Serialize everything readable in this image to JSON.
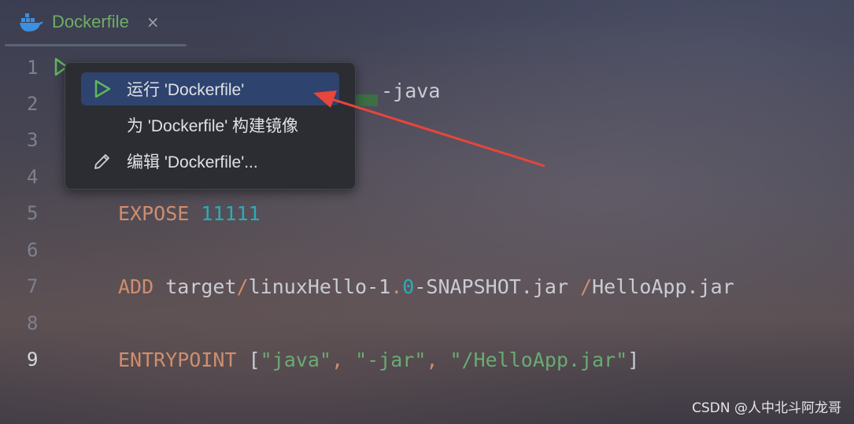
{
  "tab": {
    "title": "Dockerfile",
    "close_glyph": "×",
    "icon": "docker-icon"
  },
  "gutter": {
    "line_numbers": [
      "1",
      "2",
      "3",
      "4",
      "5",
      "6",
      "7",
      "8",
      "9"
    ],
    "active_line": "9"
  },
  "code": {
    "line1": {
      "partial": "-java"
    },
    "line5": {
      "keyword": "EXPOSE",
      "number": "11111"
    },
    "line7": {
      "keyword": "ADD",
      "p1": "target",
      "slash1": "/",
      "p2": "linuxHello-1",
      "dot": ".",
      "zero": "0",
      "p3": "-SNAPSHOT.jar ",
      "slash2": "/",
      "p4": "HelloApp.jar"
    },
    "line9": {
      "keyword": "ENTRYPOINT",
      "open": "[",
      "s1": "\"java\"",
      "comma1": ", ",
      "s2": "\"-jar\"",
      "comma2": ", ",
      "s3": "\"/HelloApp.jar\"",
      "close": "]"
    }
  },
  "context_menu": {
    "items": [
      {
        "label": "运行 'Dockerfile'",
        "icon": "run-icon",
        "selected": true
      },
      {
        "label": "为 'Dockerfile' 构建镜像",
        "icon": "",
        "selected": false
      },
      {
        "label": "编辑 'Dockerfile'...",
        "icon": "pencil-icon",
        "selected": false
      }
    ]
  },
  "colors": {
    "accent_run": "#5fb85a",
    "selection": "#2e436e",
    "arrow": "#e8453c"
  },
  "watermark": "CSDN @人中北斗阿龙哥"
}
